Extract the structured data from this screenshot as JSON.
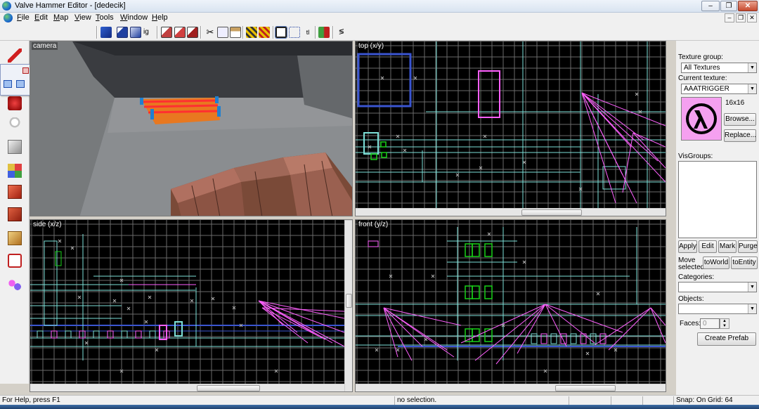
{
  "window": {
    "title": "Valve Hammer Editor - [dedecik]",
    "controls": {
      "minimize": "–",
      "maximize": "❐",
      "close": "✕"
    }
  },
  "menu": {
    "items": [
      "File",
      "Edit",
      "Map",
      "View",
      "Tools",
      "Window",
      "Help"
    ],
    "mdi_controls": {
      "minimize": "–",
      "restore": "❐",
      "close": "✕"
    }
  },
  "toolbar": {
    "tools": [
      "cube-icon",
      "group-icon",
      "ungroup-icon",
      "ignore-group-icon",
      "hide-selection-icon",
      "show-all-icon",
      "cut-icon",
      "copy-icon",
      "paste-icon",
      "texture-lock-icon",
      "texture-scale-lock-icon",
      "selection-box-icon",
      "grid-toggle-icon",
      "handles-icon",
      "carve-icon",
      "clip-icon",
      "run-map-icon"
    ],
    "ig_label": "ig",
    "tl_label": "tl"
  },
  "left_tools": [
    "pointer-tool",
    "magnify-tool",
    "camera-tool",
    "entity-tool",
    "block-tool",
    "texture-application-tool",
    "apply-current-texture-tool",
    "decal-tool",
    "clipping-tool",
    "vertex-manipulation-tool",
    "path-tool"
  ],
  "viewports": {
    "camera": {
      "label": "camera"
    },
    "top": {
      "label": "top (x/y)"
    },
    "side": {
      "label": "side (x/z)"
    },
    "front": {
      "label": "front (y/z)"
    }
  },
  "right_panel": {
    "texture_group_label": "Texture group:",
    "texture_group_value": "All Textures",
    "current_texture_label": "Current texture:",
    "current_texture_value": "AAATRIGGER",
    "texture_size": "16x16",
    "browse_label": "Browse...",
    "replace_label": "Replace...",
    "visgroups_label": "VisGroups:",
    "visgroup_buttons": [
      "Apply",
      "Edit",
      "Mark",
      "Purge"
    ],
    "move_selected_label_1": "Move",
    "move_selected_label_2": "selected:",
    "to_world_label": "toWorld",
    "to_entity_label": "toEntity",
    "categories_label": "Categories:",
    "categories_value": "",
    "objects_label": "Objects:",
    "objects_value": "",
    "faces_label": "Faces:",
    "faces_value": "0",
    "create_prefab_label": "Create Prefab"
  },
  "status": {
    "help": "For Help, press F1",
    "selection": "no selection.",
    "snap": "Snap: On Grid: 64"
  },
  "colors": {
    "grid": "#6a6a6a",
    "grid_major": "#8c8c8c",
    "brush_cyan": "#7de0d8",
    "brush_blue": "#3a55d0",
    "entity_magenta": "#ff60ff",
    "trigger_green": "#18d018"
  }
}
